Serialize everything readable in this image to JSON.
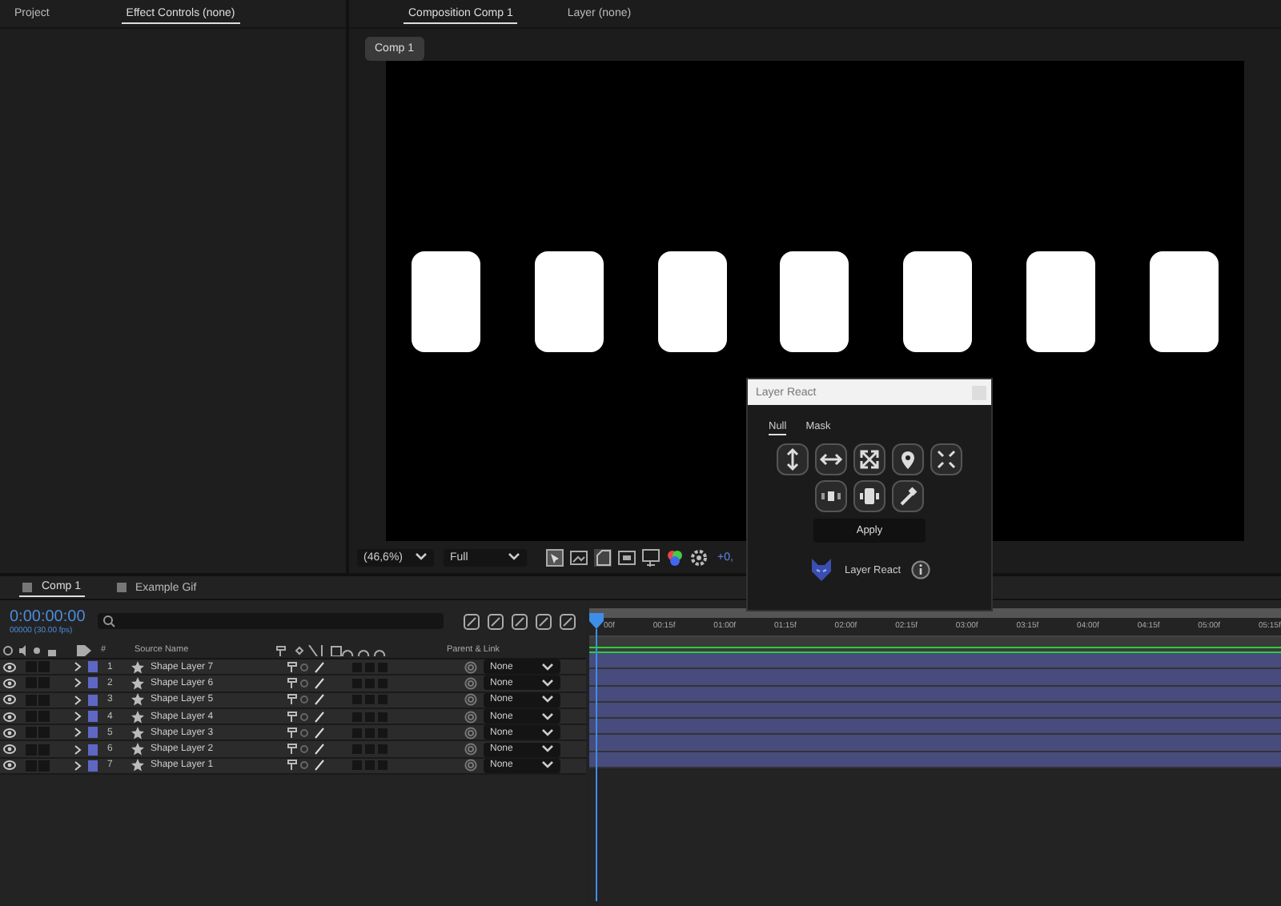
{
  "left_panel": {
    "tabs": [
      {
        "label": "Project",
        "selected": false
      },
      {
        "label": "Effect Controls (none)",
        "selected": true
      }
    ]
  },
  "composition_panel": {
    "tabs": [
      {
        "label": "Composition Comp 1",
        "selected": true
      },
      {
        "label": "Layer (none)",
        "selected": false
      }
    ],
    "breadcrumb": "Comp 1",
    "shapes": [
      {
        "kind": "rounded-rect"
      },
      {
        "kind": "rounded-rect"
      },
      {
        "kind": "rounded-rect"
      },
      {
        "kind": "rounded-rect"
      },
      {
        "kind": "rounded-rect"
      },
      {
        "kind": "rounded-rect"
      },
      {
        "kind": "rounded-rect"
      }
    ],
    "toolbar": {
      "zoom": "(46,6%)",
      "resolution": "Full",
      "exposure": "+0,"
    }
  },
  "timeline": {
    "tabs": [
      {
        "label": "Comp 1",
        "selected": true
      },
      {
        "label": "Example Gif",
        "selected": false
      }
    ],
    "timecode": "0:00:00:00",
    "frame_rate": "00000 (30.00 fps)",
    "columns": {
      "number": "#",
      "source_name": "Source Name",
      "parent": "Parent & Link"
    },
    "layers": [
      {
        "number": "1",
        "name": "Shape Layer 7",
        "parent": "None",
        "visible": true
      },
      {
        "number": "2",
        "name": "Shape Layer 6",
        "parent": "None",
        "visible": true
      },
      {
        "number": "3",
        "name": "Shape Layer 5",
        "parent": "None",
        "visible": true
      },
      {
        "number": "4",
        "name": "Shape Layer 4",
        "parent": "None",
        "visible": true
      },
      {
        "number": "5",
        "name": "Shape Layer 3",
        "parent": "None",
        "visible": true
      },
      {
        "number": "6",
        "name": "Shape Layer 2",
        "parent": "None",
        "visible": true
      },
      {
        "number": "7",
        "name": "Shape Layer 1",
        "parent": "None",
        "visible": true
      }
    ],
    "ruler": [
      "00f",
      "00:15f",
      "01:00f",
      "01:15f",
      "02:00f",
      "02:15f",
      "03:00f",
      "03:15f",
      "04:00f",
      "04:15f",
      "05:00f",
      "05:15f"
    ]
  },
  "dialog": {
    "title": "Layer React",
    "tabs": [
      {
        "label": "Null",
        "selected": true
      },
      {
        "label": "Mask",
        "selected": false
      }
    ],
    "tools": [
      {
        "kind": "vertical"
      },
      {
        "kind": "horizontal"
      },
      {
        "kind": "scale"
      },
      {
        "kind": "pin"
      },
      {
        "kind": "shrink"
      },
      {
        "kind": "squeeze"
      },
      {
        "kind": "stretch"
      },
      {
        "kind": "picker"
      }
    ],
    "apply": "Apply",
    "footer": "Layer React"
  }
}
